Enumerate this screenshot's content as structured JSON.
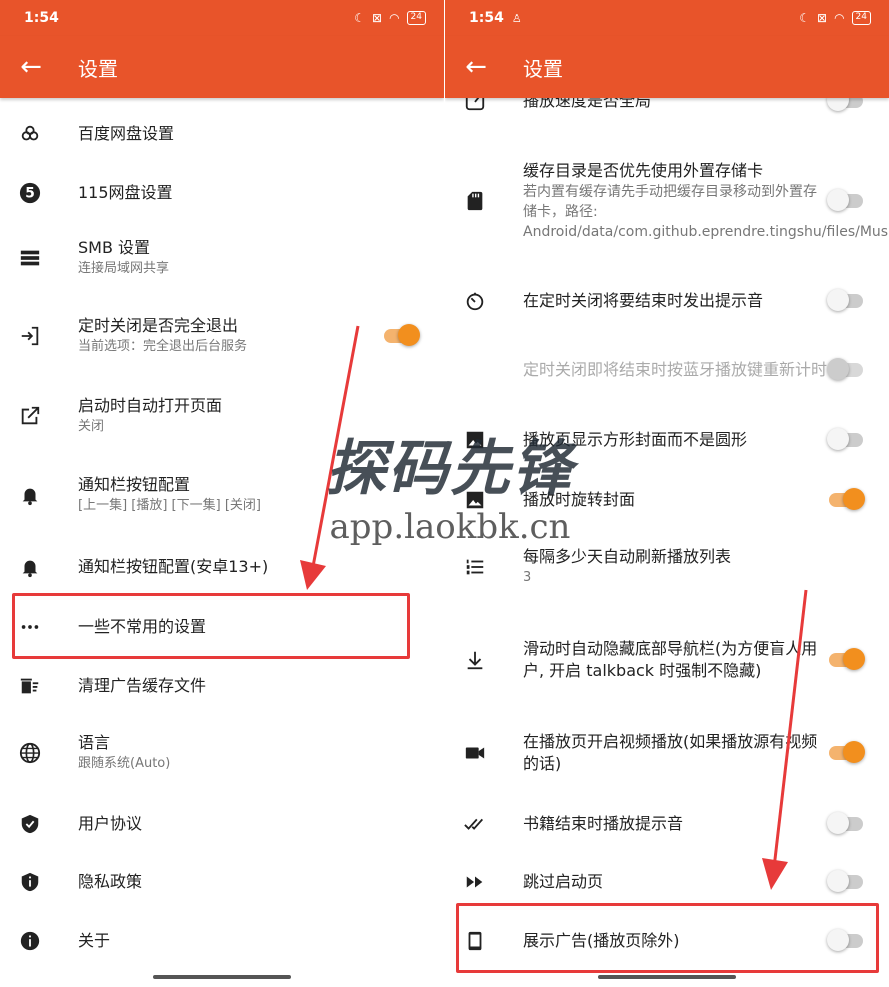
{
  "left": {
    "status": {
      "time": "1:54",
      "battery": "24"
    },
    "title": "设置",
    "items": [
      {
        "label": "百度网盘设置",
        "icon": "cloud-icon"
      },
      {
        "label": "115网盘设置",
        "icon": "five-icon"
      },
      {
        "label": "SMB 设置",
        "sub": "连接局域网共享",
        "icon": "storage-icon"
      },
      {
        "label": "定时关闭是否完全退出",
        "sub": "当前选项：完全退出后台服务",
        "icon": "exit-icon",
        "toggle": true
      },
      {
        "label": "启动时自动打开页面",
        "sub": "关闭",
        "icon": "open-in-new-icon"
      },
      {
        "label": "通知栏按钮配置",
        "sub": "[上一集] [播放] [下一集] [关闭]",
        "icon": "bell-icon"
      },
      {
        "label": "通知栏按钮配置(安卓13+)",
        "icon": "bell-icon"
      },
      {
        "label": "一些不常用的设置",
        "icon": "more-horiz-icon"
      },
      {
        "label": "清理广告缓存文件",
        "icon": "delete-sweep-icon"
      },
      {
        "label": "语言",
        "sub": "跟随系统(Auto)",
        "icon": "globe-icon"
      },
      {
        "label": "用户协议",
        "icon": "shield-check-icon"
      },
      {
        "label": "隐私政策",
        "icon": "shield-info-icon"
      },
      {
        "label": "关于",
        "icon": "info-icon"
      }
    ]
  },
  "right": {
    "status": {
      "time": "1:54",
      "battery": "24"
    },
    "title": "设置",
    "items": [
      {
        "label": "播放速度是否全局",
        "icon": "speed-icon",
        "toggle": false
      },
      {
        "label": "缓存目录是否优先使用外置存储卡",
        "sub": "若内置有缓存请先手动把缓存目录移动到外置存储卡，路径: Android/data/com.github.eprendre.tingshu/files/Music",
        "icon": "sd-card-icon",
        "toggle": false
      },
      {
        "label": "在定时关闭将要结束时发出提示音",
        "icon": "timer-icon",
        "toggle": false
      },
      {
        "label": "定时关闭即将结束时按蓝牙播放键重新计时",
        "icon": "",
        "toggle": false,
        "disabled": true
      },
      {
        "label": "播放页显示方形封面而不是圆形",
        "icon": "image-icon",
        "toggle": false
      },
      {
        "label": "播放时旋转封面",
        "icon": "image-icon",
        "toggle": true
      },
      {
        "label": "每隔多少天自动刷新播放列表",
        "sub": "3",
        "icon": "list-numbered-icon"
      },
      {
        "label": "滑动时自动隐藏底部导航栏(为方便盲人用户, 开启 talkback 时强制不隐藏)",
        "icon": "download-icon",
        "toggle": true
      },
      {
        "label": "在播放页开启视频播放(如果播放源有视频的话)",
        "icon": "videocam-icon",
        "toggle": true
      },
      {
        "label": "书籍结束时播放提示音",
        "icon": "double-check-icon",
        "toggle": false
      },
      {
        "label": "跳过启动页",
        "icon": "fast-forward-icon",
        "toggle": false
      },
      {
        "label": "展示广告(播放页除外)",
        "icon": "phone-icon",
        "toggle": false
      }
    ]
  },
  "watermark": {
    "line1": "探码先锋",
    "line2": "app.laokbk.cn"
  },
  "colors": {
    "accent": "#e8542a",
    "toggle_on": "#f28f1e",
    "highlight": "#e73a3a"
  }
}
